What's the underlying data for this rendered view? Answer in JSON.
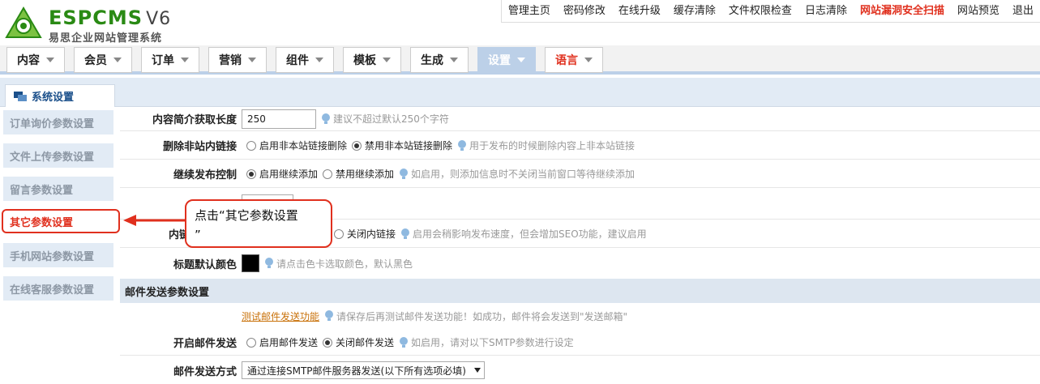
{
  "brand": {
    "name": "ESPCMS",
    "version": "V6",
    "subtitle": "易思企业网站管理系统",
    "color": "#2a8a14"
  },
  "toplinks": [
    {
      "label": "管理主页"
    },
    {
      "label": "密码修改"
    },
    {
      "label": "在线升级"
    },
    {
      "label": "缓存清除"
    },
    {
      "label": "文件权限检查"
    },
    {
      "label": "日志清除"
    },
    {
      "label": "网站漏洞安全扫描"
    },
    {
      "label": "网站预览"
    },
    {
      "label": "退出"
    }
  ],
  "nav": [
    {
      "label": "内容"
    },
    {
      "label": "会员"
    },
    {
      "label": "订单"
    },
    {
      "label": "营销"
    },
    {
      "label": "组件"
    },
    {
      "label": "模板"
    },
    {
      "label": "生成"
    },
    {
      "label": "设置"
    },
    {
      "label": "语言"
    }
  ],
  "subtab": {
    "label": "系统设置"
  },
  "sidebar": {
    "items": [
      {
        "label": "订单询价参数设置"
      },
      {
        "label": "文件上传参数设置"
      },
      {
        "label": "留言参数设置"
      },
      {
        "label": "其它参数设置"
      },
      {
        "label": "手机网站参数设置"
      },
      {
        "label": "在线客服参数设置"
      }
    ]
  },
  "form": {
    "intro_length": {
      "label": "内容简介获取长度",
      "value": "250",
      "hint": "建议不超过默认250个字符"
    },
    "remove_links": {
      "label": "删除非站内链接",
      "opt_on": "启用非本站链接删除",
      "opt_off": "禁用非本站链接删除",
      "hint": "用于发布的时候删除内容上非本站链接"
    },
    "continue_publish": {
      "label": "继续发布控制",
      "opt_on": "启用继续添加",
      "opt_off": "禁用继续添加",
      "hint": "如启用，则添加信息时不关闭当前窗口等待继续添加"
    },
    "inner_links": {
      "label": "内链",
      "opt_off": "关闭内链接",
      "hint": "启用会稍影响发布速度，但会增加SEO功能，建议启用"
    },
    "title_color": {
      "label": "标题默认颜色",
      "hint": "请点击色卡选取颜色，默认黑色",
      "swatch": "#000000"
    }
  },
  "mail": {
    "section_title": "邮件发送参数设置",
    "test_link": "测试邮件发送功能",
    "test_hint": "请保存后再测试邮件发送功能！如成功，邮件将会发送到\"发送邮箱\"",
    "enable": {
      "label": "开启邮件发送",
      "opt_on": "启用邮件发送",
      "opt_off": "关闭邮件发送",
      "hint": "如启用，请对以下SMTP参数进行设定"
    },
    "method": {
      "label": "邮件发送方式",
      "selected": "通过连接SMTP邮件服务器发送(以下所有选项必填)"
    }
  },
  "annotation": {
    "line1": "点击“其它参数设置",
    "line2": "”",
    "color": "#e0301e"
  }
}
